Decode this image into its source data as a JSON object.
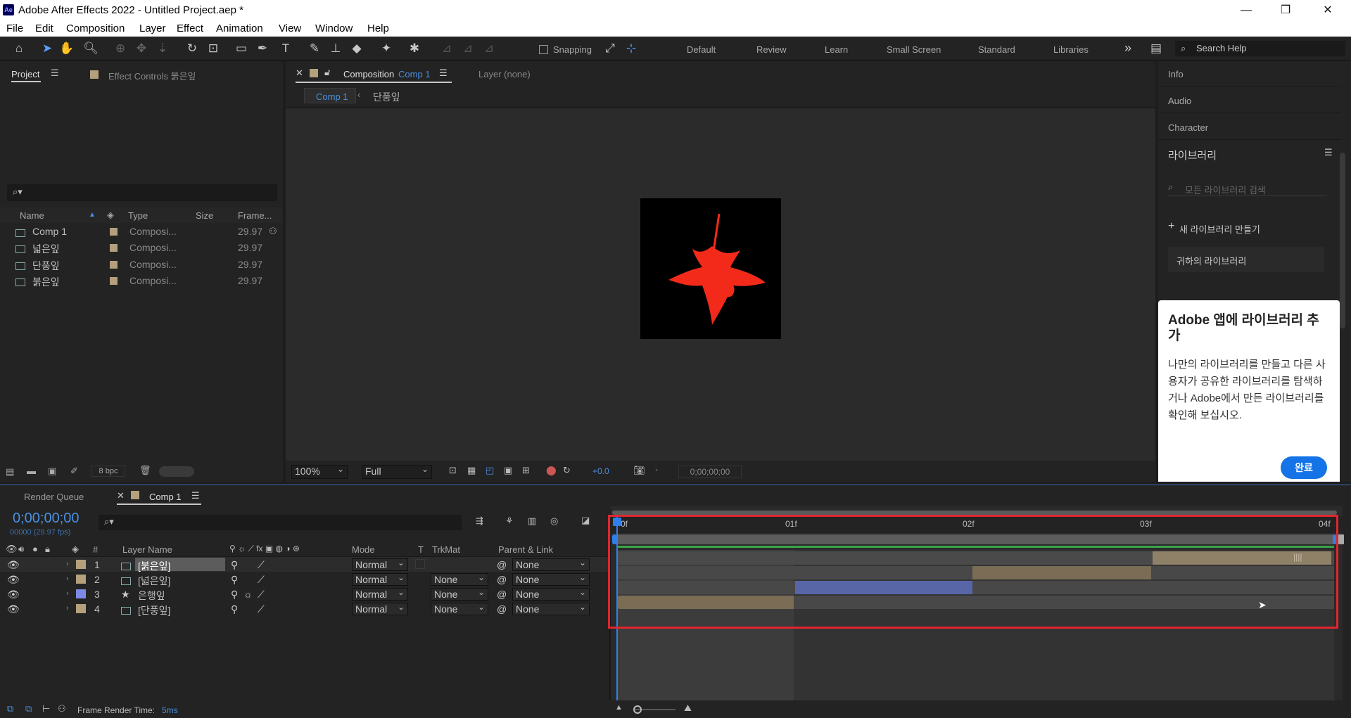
{
  "app": {
    "title": "Adobe After Effects 2022 - Untitled Project.aep *",
    "icon": "Ae"
  },
  "window_controls": {
    "minimize": "—",
    "restore": "❐",
    "close": "✕"
  },
  "menu": [
    "File",
    "Edit",
    "Composition",
    "Layer",
    "Effect",
    "Animation",
    "View",
    "Window",
    "Help"
  ],
  "toolbar": {
    "snapping_label": "Snapping",
    "workspaces": [
      "Default",
      "Review",
      "Learn",
      "Small Screen",
      "Standard",
      "Libraries"
    ],
    "more": "»",
    "search_placeholder": "Search Help"
  },
  "project_panel": {
    "tab_project": "Project",
    "tab_effect_controls": "Effect Controls 붉은잎",
    "columns": {
      "name": "Name",
      "type": "Type",
      "size": "Size",
      "frame": "Frame..."
    },
    "items": [
      {
        "name": "Comp 1",
        "type": "Composi...",
        "frame": "29.97"
      },
      {
        "name": "넓은잎",
        "type": "Composi...",
        "frame": "29.97"
      },
      {
        "name": "단풍잎",
        "type": "Composi...",
        "frame": "29.97"
      },
      {
        "name": "붉은잎",
        "type": "Composi...",
        "frame": "29.97"
      }
    ],
    "bpc": "8 bpc"
  },
  "comp_panel": {
    "tab_prefix": "Composition",
    "tab_comp": "Comp 1",
    "tab_layer": "Layer (none)",
    "breadcrumb_comp": "Comp 1",
    "breadcrumb_child": "단풍잎",
    "zoom": "100%",
    "resolution": "Full",
    "exposure": "+0.0",
    "timecode": "0;00;00;00",
    "leaf_color": "#f32a1a"
  },
  "right_panel": {
    "info": "Info",
    "audio": "Audio",
    "character": "Character",
    "libraries_title": "라이브러리",
    "search_placeholder": "모든 라이브러리 검색",
    "new_library": "새 라이브러리 만들기",
    "your_library": "귀하의 라이브러리",
    "callout_title": "Adobe 앱에 라이브러리 추가",
    "callout_body": "나만의 라이브러리를 만들고 다른 사용자가 공유한 라이브러리를 탐색하거나 Adobe에서 만든 라이브러리를 확인해 보십시오.",
    "callout_button": "완료"
  },
  "timeline": {
    "tab_render_queue": "Render Queue",
    "tab_comp": "Comp 1",
    "timecode": "0;00;00;00",
    "fps": "00000 (29.97 fps)",
    "columns": {
      "num": "#",
      "layer_name": "Layer Name",
      "mode": "Mode",
      "t": "T",
      "trkmat": "TrkMat",
      "parent": "Parent & Link"
    },
    "ruler": [
      "0f",
      "01f",
      "02f",
      "03f",
      "04f"
    ],
    "layers": [
      {
        "num": "1",
        "name": "[붉은잎]",
        "mode": "Normal",
        "trkmat": "",
        "parent": "None",
        "label_color": "#b5a07c",
        "selected": true
      },
      {
        "num": "2",
        "name": "[넓은잎]",
        "mode": "Normal",
        "trkmat": "None",
        "parent": "None",
        "label_color": "#b5a07c",
        "selected": false
      },
      {
        "num": "3",
        "name": "은행잎",
        "mode": "Normal",
        "trkmat": "None",
        "parent": "None",
        "label_color": "#7e88e6",
        "selected": false
      },
      {
        "num": "4",
        "name": "[단풍잎]",
        "mode": "Normal",
        "trkmat": "None",
        "parent": "None",
        "label_color": "#b5a07c",
        "selected": false
      }
    ],
    "render_time_label": "Frame Render Time:",
    "render_time_value": "5ms"
  }
}
